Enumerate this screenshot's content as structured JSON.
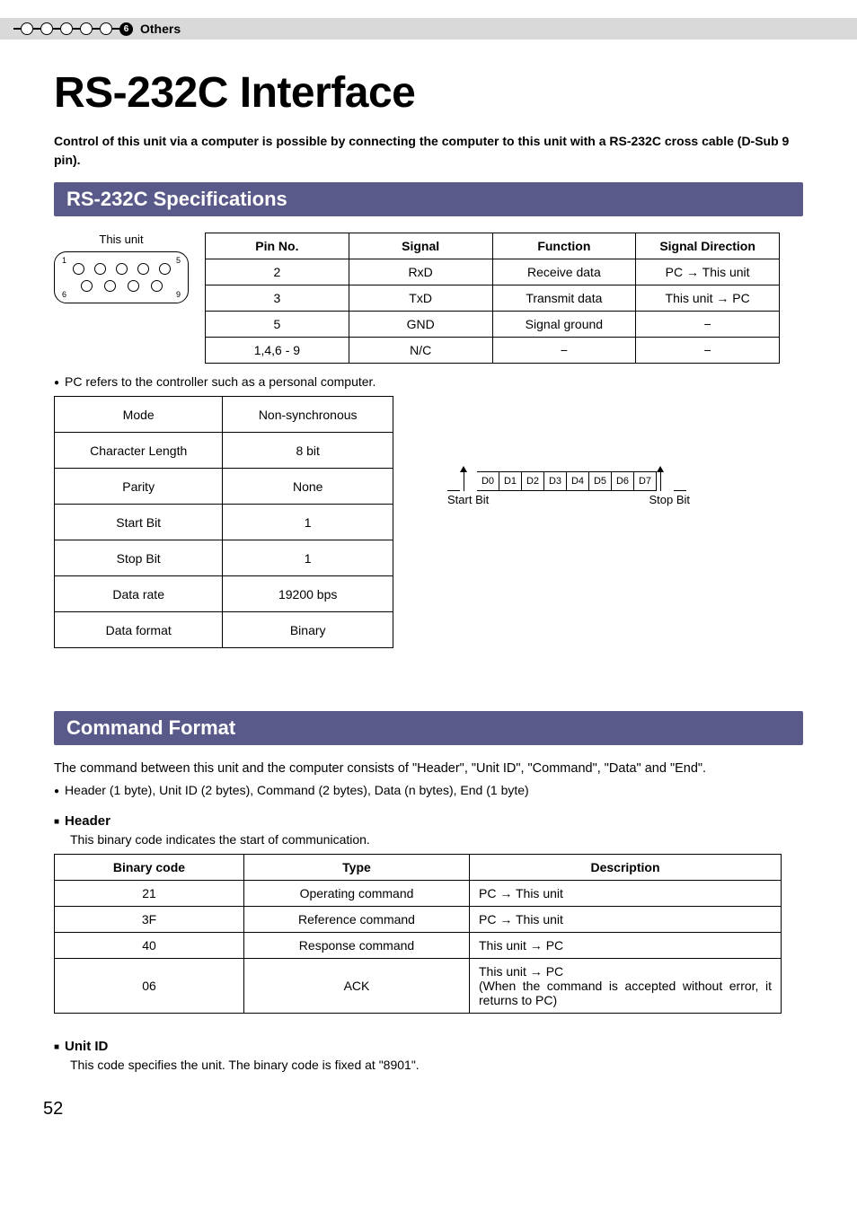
{
  "topbar": {
    "section_number": "6",
    "section_label": "Others"
  },
  "title": "RS-232C Interface",
  "intro": "Control of this unit via a computer is possible by connecting the computer to this unit with a RS-232C cross cable (D-Sub 9 pin).",
  "spec_heading": "RS-232C Specifications",
  "unit_label": "This unit",
  "pin_labels": {
    "tl": "1",
    "tr": "5",
    "bl": "6",
    "br": "9"
  },
  "spec_table": {
    "headers": [
      "Pin No.",
      "Signal",
      "Function",
      "Signal Direction"
    ],
    "rows": [
      [
        "2",
        "RxD",
        "Receive data",
        "PC → This unit"
      ],
      [
        "3",
        "TxD",
        "Transmit data",
        "This unit → PC"
      ],
      [
        "5",
        "GND",
        "Signal ground",
        "−"
      ],
      [
        "1,4,6 - 9",
        "N/C",
        "−",
        "−"
      ]
    ]
  },
  "pc_note": "PC refers to the controller such as a personal computer.",
  "params_table": {
    "rows": [
      [
        "Mode",
        "Non-synchronous"
      ],
      [
        "Character Length",
        "8 bit"
      ],
      [
        "Parity",
        "None"
      ],
      [
        "Start Bit",
        "1"
      ],
      [
        "Stop Bit",
        "1"
      ],
      [
        "Data rate",
        "19200 bps"
      ],
      [
        "Data format",
        "Binary"
      ]
    ]
  },
  "bits": [
    "D0",
    "D1",
    "D2",
    "D3",
    "D4",
    "D5",
    "D6",
    "D7"
  ],
  "bit_start": "Start Bit",
  "bit_stop": "Stop Bit",
  "cmd_heading": "Command Format",
  "cmd_intro": "The command between this unit and the computer consists of \"Header\", \"Unit ID\", \"Command\", \"Data\" and \"End\".",
  "cmd_detail": "Header (1 byte), Unit ID (2 bytes), Command (2 bytes), Data (n bytes), End (1 byte)",
  "header_sub": "Header",
  "header_sub_p": "This binary code indicates the start of communication.",
  "header_table": {
    "headers": [
      "Binary code",
      "Type",
      "Description"
    ],
    "rows": [
      [
        "21",
        "Operating command",
        "PC → This unit"
      ],
      [
        "3F",
        "Reference command",
        "PC → This unit"
      ],
      [
        "40",
        "Response command",
        "This unit → PC"
      ],
      [
        "06",
        "ACK",
        "This unit → PC\n(When the command is accepted without error, it returns to PC)"
      ]
    ]
  },
  "unitid_sub": "Unit ID",
  "unitid_p": "This code specifies the unit. The binary code is fixed at \"8901\".",
  "page_number": "52"
}
